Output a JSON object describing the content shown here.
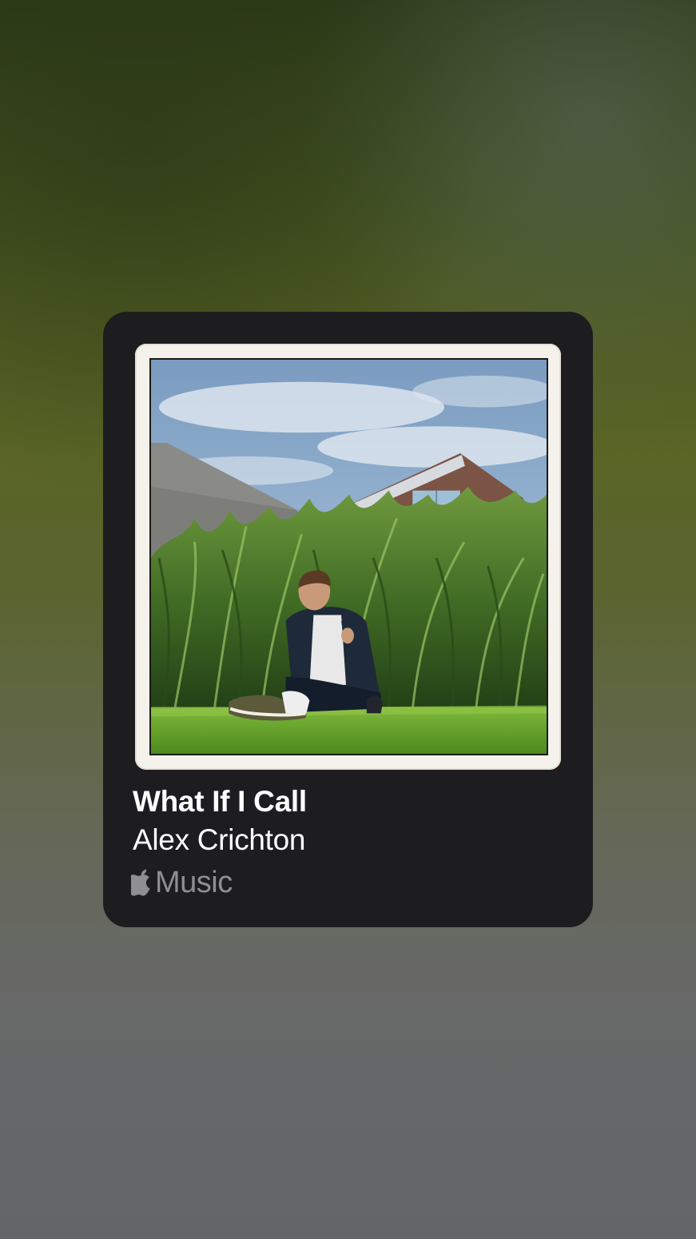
{
  "card": {
    "song_title": "What If I Call",
    "artist": "Alex Crichton",
    "service": {
      "icon": "apple-logo-icon",
      "label": "Music"
    }
  },
  "colors": {
    "card_background": "#1d1d1f",
    "title_text": "#ffffff",
    "service_text": "#8e8e93"
  }
}
